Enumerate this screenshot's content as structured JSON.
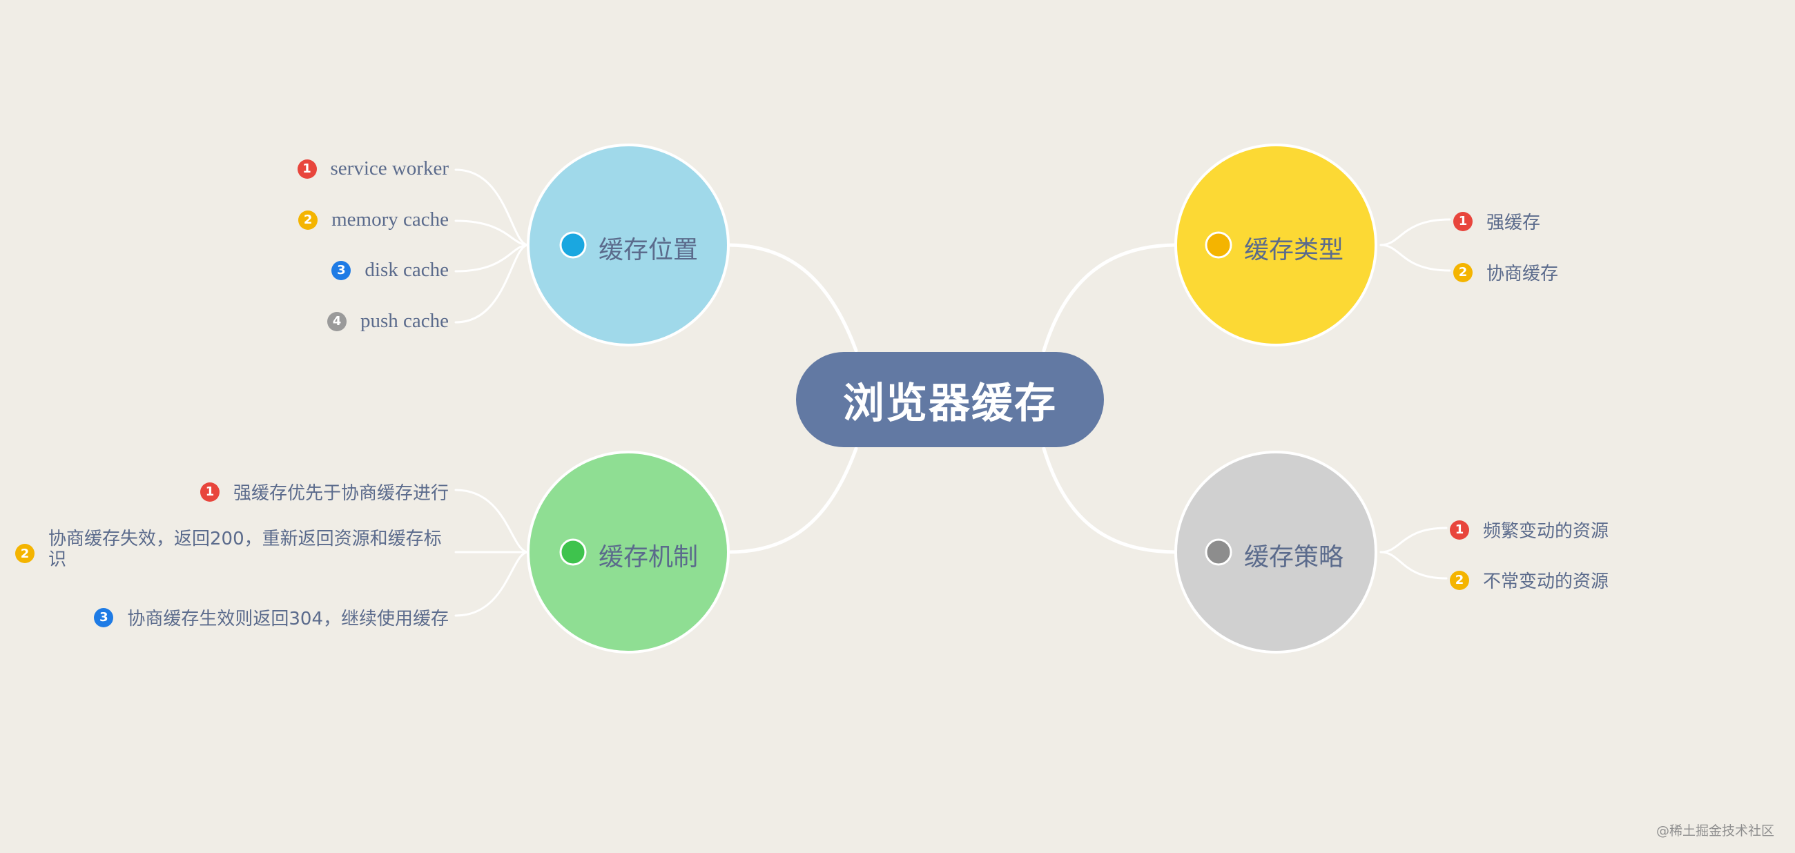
{
  "center": {
    "label": "浏览器缓存",
    "color": "#6279a3"
  },
  "topics": {
    "location": {
      "label": "缓存位置",
      "fill": "#a0d9ea",
      "dot": "#1aa7e0",
      "items": [
        {
          "num": "1",
          "color": "#e8453c",
          "label": "service worker"
        },
        {
          "num": "2",
          "color": "#f4b400",
          "label": "memory cache"
        },
        {
          "num": "3",
          "color": "#1e7be5",
          "label": "disk cache"
        },
        {
          "num": "4",
          "color": "#9a9a9a",
          "label": "push cache"
        }
      ]
    },
    "type": {
      "label": "缓存类型",
      "fill": "#fcd934",
      "dot": "#f4b400",
      "items": [
        {
          "num": "1",
          "color": "#e8453c",
          "label": "强缓存"
        },
        {
          "num": "2",
          "color": "#f4b400",
          "label": "协商缓存"
        }
      ]
    },
    "mechanism": {
      "label": "缓存机制",
      "fill": "#8fde93",
      "dot": "#3ec34d",
      "items": [
        {
          "num": "1",
          "color": "#e8453c",
          "label": "强缓存优先于协商缓存进行"
        },
        {
          "num": "2",
          "color": "#f4b400",
          "label": "协商缓存失效，返回200，重新返回资源和缓存标",
          "label2": "识"
        },
        {
          "num": "3",
          "color": "#1e7be5",
          "label": "协商缓存生效则返回304，继续使用缓存"
        }
      ]
    },
    "strategy": {
      "label": "缓存策略",
      "fill": "#d0d0d0",
      "dot": "#8d8d8d",
      "items": [
        {
          "num": "1",
          "color": "#e8453c",
          "label": "频繁变动的资源"
        },
        {
          "num": "2",
          "color": "#f4b400",
          "label": "不常变动的资源"
        }
      ]
    }
  },
  "watermark": "@稀土掘金技术社区"
}
